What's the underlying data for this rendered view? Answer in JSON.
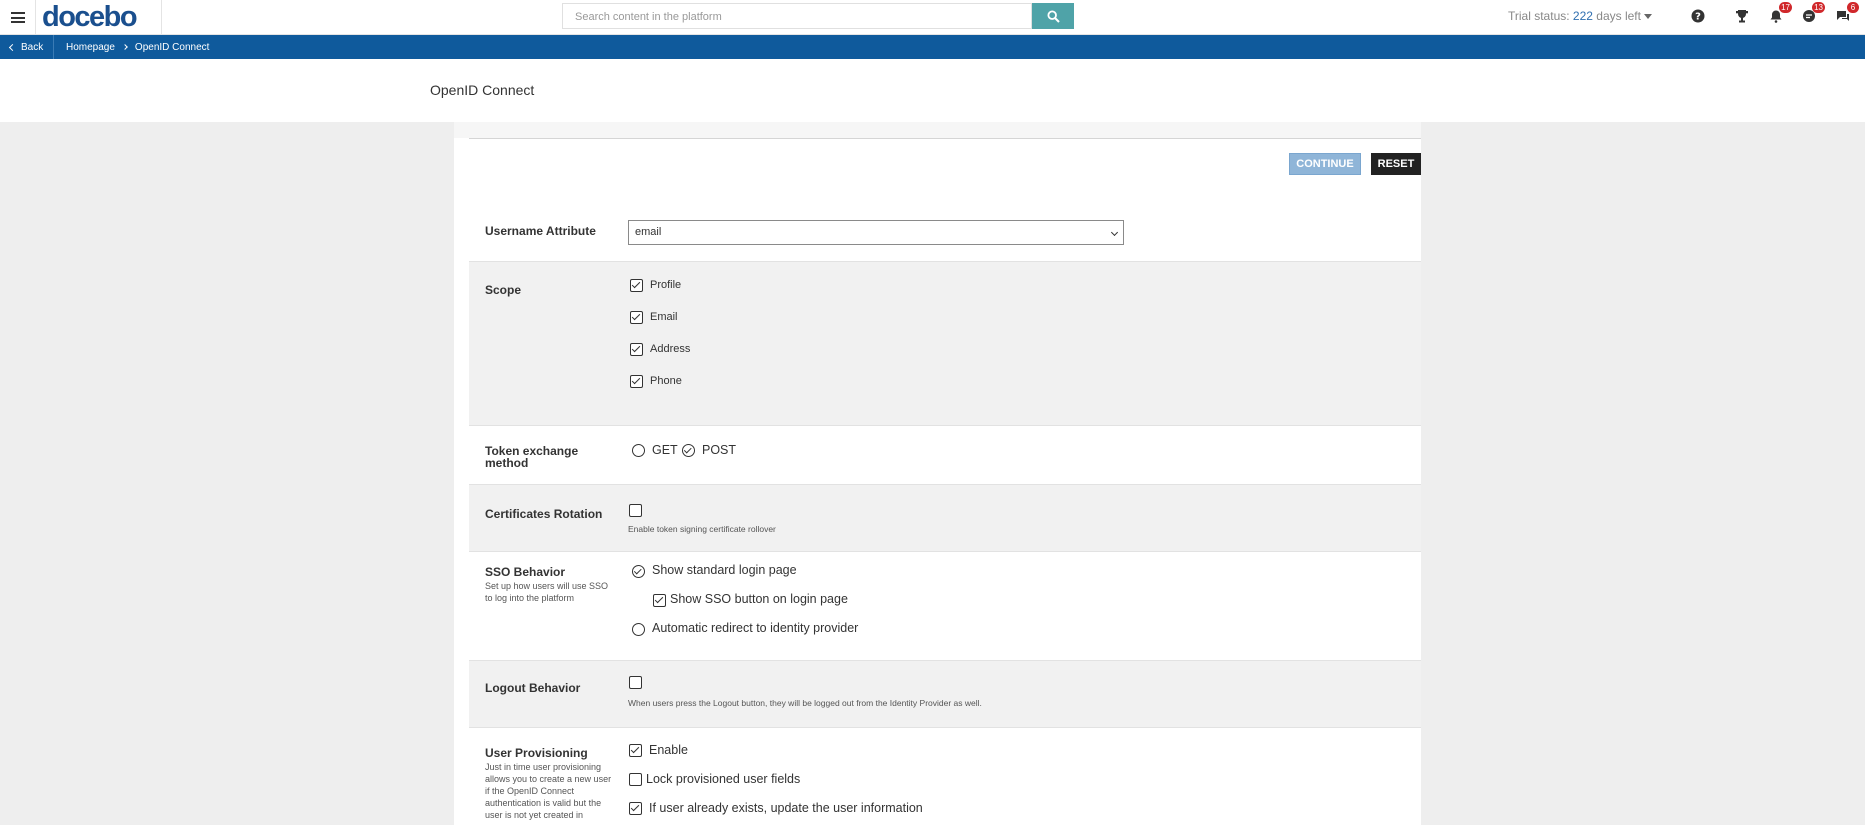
{
  "header": {
    "logo": "docebo",
    "search_placeholder": "Search content in the platform",
    "trial_prefix": "Trial status: ",
    "trial_days": "222",
    "trial_suffix": " days left",
    "badges": {
      "notifications": "17",
      "messages": "13",
      "chat": "6"
    }
  },
  "breadcrumb": {
    "back_label": "Back",
    "items": [
      "Homepage",
      "OpenID Connect"
    ]
  },
  "page": {
    "title": "OpenID Connect"
  },
  "actions": {
    "continue_label": "CONTINUE",
    "reset_label": "RESET"
  },
  "form": {
    "username_attribute": {
      "label": "Username Attribute",
      "value": "email"
    },
    "scope": {
      "label": "Scope",
      "options": [
        {
          "label": "Profile",
          "checked": true
        },
        {
          "label": "Email",
          "checked": true
        },
        {
          "label": "Address",
          "checked": true
        },
        {
          "label": "Phone",
          "checked": true
        }
      ]
    },
    "token_exchange": {
      "label": "Token exchange method",
      "options": [
        {
          "label": "GET",
          "selected": false
        },
        {
          "label": "POST",
          "selected": true
        }
      ]
    },
    "certificates_rotation": {
      "label": "Certificates Rotation",
      "checked": false,
      "help": "Enable token signing certificate rollover"
    },
    "sso_behavior": {
      "label": "SSO Behavior",
      "description": "Set up how users will use SSO to log into the platform",
      "standard_login": "Show standard login page",
      "sso_button": "Show SSO button on login page",
      "auto_redirect": "Automatic redirect to identity provider"
    },
    "logout_behavior": {
      "label": "Logout Behavior",
      "checked": false,
      "help": "When users press the Logout button, they will be logged out from the Identity Provider as well."
    },
    "user_provisioning": {
      "label": "User Provisioning",
      "description": "Just in time user provisioning allows you to create a new user if the OpenID Connect authentication is valid but the user is not yet created in",
      "enable": "Enable",
      "lock_fields": "Lock provisioned user fields",
      "update_existing": "If user already exists, update the user information"
    }
  }
}
